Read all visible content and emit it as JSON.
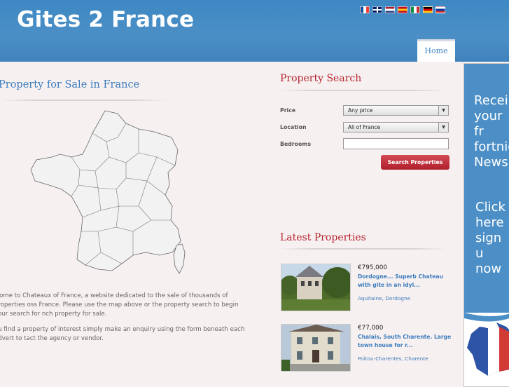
{
  "header": {
    "logo": "Gites 2 France",
    "flags": [
      {
        "name": "french-flag-icon",
        "colors": [
          "#0055a4",
          "#ffffff",
          "#ef4135"
        ]
      },
      {
        "name": "uk-flag-icon",
        "colors": [
          "#012169",
          "#ffffff",
          "#c8102e"
        ]
      },
      {
        "name": "dutch-flag-icon",
        "colors": [
          "#ae1c28",
          "#ffffff",
          "#21468b"
        ]
      },
      {
        "name": "spanish-flag-icon",
        "colors": [
          "#c60b1e",
          "#ffc400",
          "#c60b1e"
        ]
      },
      {
        "name": "italian-flag-icon",
        "colors": [
          "#009246",
          "#ffffff",
          "#ce2b37"
        ]
      },
      {
        "name": "german-flag-icon",
        "colors": [
          "#000000",
          "#dd0000",
          "#ffce00"
        ]
      },
      {
        "name": "russian-flag-icon",
        "colors": [
          "#ffffff",
          "#0039a6",
          "#d52b1e"
        ]
      }
    ]
  },
  "nav": {
    "home": "Home"
  },
  "main": {
    "title": "Property for Sale in France",
    "paragraph1": "lcome to Chateaux of France, a website dedicated to the sale of thousands of properties oss France. Please use the map above or the property search to begin your search for nch property for sale.",
    "paragraph2": "ou find a property of interest simply make an enquiry using the form beneath each advert to tact the agency or vendor."
  },
  "search": {
    "title": "Property Search",
    "price_label": "Price",
    "price_value": "Any price",
    "location_label": "Location",
    "location_value": "All of France",
    "bedrooms_label": "Bedrooms",
    "bedrooms_value": "",
    "button": "Search Properties"
  },
  "latest": {
    "title": "Latest Properties",
    "items": [
      {
        "price": "€795,000",
        "title": "Dordogne... Superb Chateau with gite in an idyl...",
        "location": "Aquitaine, Dordogne"
      },
      {
        "price": "€77,000",
        "title": "Chalais, South Charente. Large town house for r...",
        "location": "Poitou-Charentes, Charente"
      }
    ]
  },
  "sidebar": {
    "text1": "Recei your fr fortnigh Newsle",
    "text2": "Click here sign u now"
  },
  "colors": {
    "header": "#4c8fc6",
    "accent_red": "#b5242f",
    "link_blue": "#3b7cbd"
  }
}
